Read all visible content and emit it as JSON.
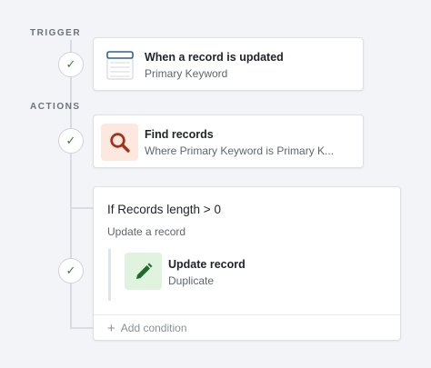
{
  "sections": {
    "trigger_label": "TRIGGER",
    "actions_label": "ACTIONS"
  },
  "trigger": {
    "title": "When a record is updated",
    "subtitle": "Primary Keyword",
    "icon": "table-window-icon"
  },
  "find_step": {
    "title": "Find records",
    "subtitle": "Where Primary Keyword is Primary K...",
    "icon": "search-icon",
    "icon_bg": "#fde8df",
    "icon_color": "#a3321b"
  },
  "condition": {
    "title": "If Records length > 0",
    "subtitle": "Update a record",
    "add_label": "Add condition",
    "update_step": {
      "title": "Update record",
      "subtitle": "Duplicate",
      "icon": "pencil-icon",
      "icon_bg": "#dff3df",
      "icon_color": "#1f6b2a"
    }
  },
  "colors": {
    "check": "#3a7d3a",
    "trigger_icon_blue": "#2b5f9e"
  }
}
